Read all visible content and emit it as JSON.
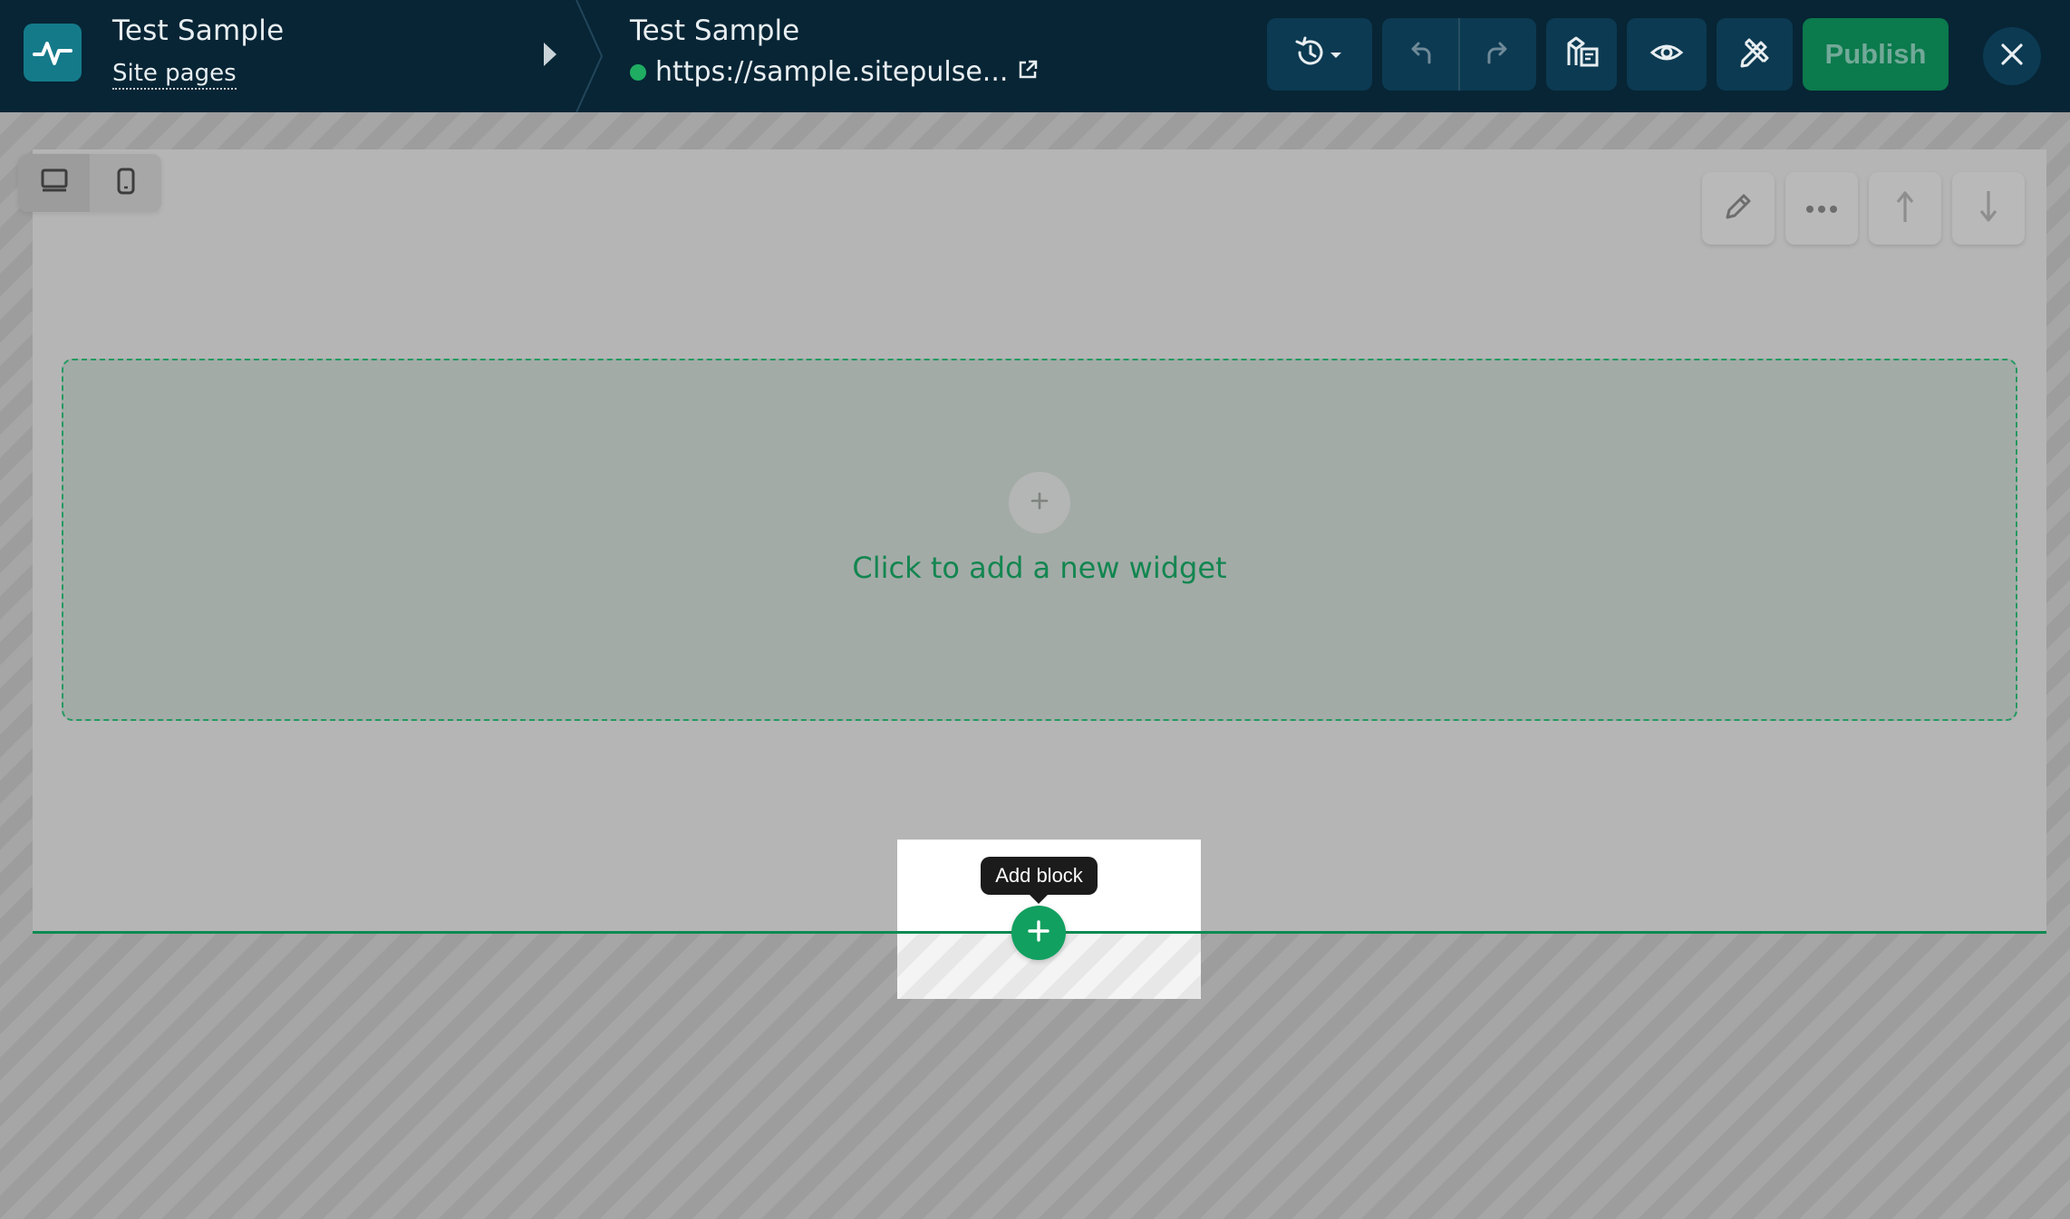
{
  "header": {
    "site_title": "Test Sample",
    "site_pages_link": "Site pages",
    "page_title": "Test Sample",
    "page_url": "https://sample.sitepulse...",
    "publish_label": "Publish"
  },
  "colors": {
    "topbar_bg": "#072535",
    "accent_green": "#12a060",
    "publish_bg": "#0b7a4c",
    "status_online": "#1fad62"
  },
  "toolbar_icons": [
    "history-icon",
    "undo-icon",
    "redo-icon",
    "layers-icon",
    "preview-eye-icon",
    "design-tools-icon",
    "close-icon"
  ],
  "device_toggle": {
    "active": "desktop",
    "options": [
      "desktop-icon",
      "mobile-icon"
    ]
  },
  "section_actions": [
    "edit-pencil-icon",
    "more-options-icon",
    "move-up-icon",
    "move-down-icon"
  ],
  "canvas": {
    "widget_placeholder": "Click to add a new widget",
    "add_block_tooltip": "Add block"
  }
}
